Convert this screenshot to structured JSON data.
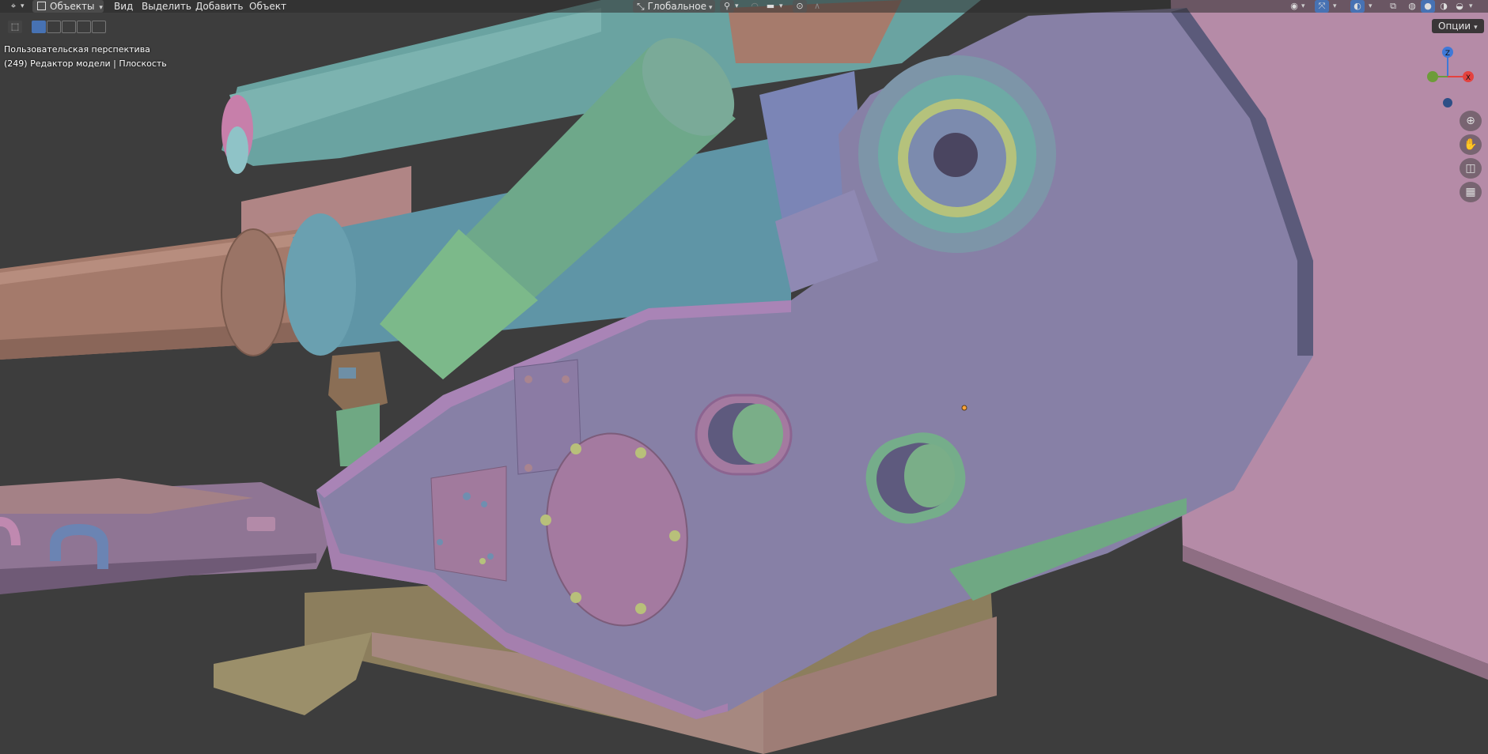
{
  "header": {
    "mode_label": "Объекты",
    "menu": {
      "view": "Вид",
      "select": "Выделить",
      "add": "Добавить",
      "object": "Объект"
    },
    "transform_orientation": "Глобальное",
    "options_label": "Опции"
  },
  "viewport_info": {
    "perspective": "Пользовательская перспектива",
    "context": "(249) Редактор модели | Плоскость"
  },
  "gizmo": {
    "x_label": "X",
    "y_label": "Y",
    "z_label": "Z"
  },
  "icons": [
    "editor-type-icon",
    "object-mode-icon",
    "select-box-icon",
    "select-mode-new-icon",
    "select-mode-extend-icon",
    "select-mode-subtract-icon",
    "select-mode-invert-icon",
    "select-mode-intersect-icon",
    "transform-orientation-icon",
    "pivot-icon",
    "snap-icon",
    "proportional-edit-icon",
    "visibility-icon",
    "gizmo-icon",
    "overlay-icon",
    "xray-icon",
    "wireframe-shading-icon",
    "solid-shading-icon",
    "material-shading-icon",
    "rendered-shading-icon",
    "zoom-icon",
    "hand-icon",
    "camera-icon",
    "grid-icon"
  ],
  "colors": {
    "background": "#3d3d3d",
    "header": "#2c2c2c",
    "axis_x": "#e4423f",
    "axis_y": "#6d9c3a",
    "axis_z": "#3f79d8",
    "active_blue": "#4772b3"
  }
}
